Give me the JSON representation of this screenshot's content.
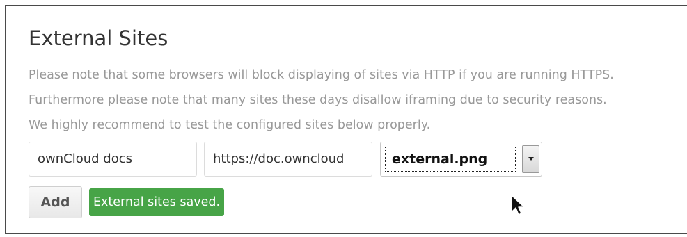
{
  "section": {
    "title": "External Sites",
    "notes": [
      "Please note that some browsers will block displaying of sites via HTTP if you are running HTTPS.",
      "Furthermore please note that many sites these days disallow iframing due to security reasons.",
      "We highly recommend to test the configured sites below properly."
    ]
  },
  "site_form": {
    "name_value": "ownCloud docs",
    "url_value": "https://doc.owncloud",
    "icon_selected": "external.png",
    "add_label": "Add",
    "status_message": "External sites saved."
  },
  "colors": {
    "status_bg": "#47a447",
    "note_text": "#999999",
    "title_text": "#333333"
  },
  "icons": {
    "select_arrow": "chevron-down-icon",
    "cursor": "mouse-pointer-icon"
  }
}
